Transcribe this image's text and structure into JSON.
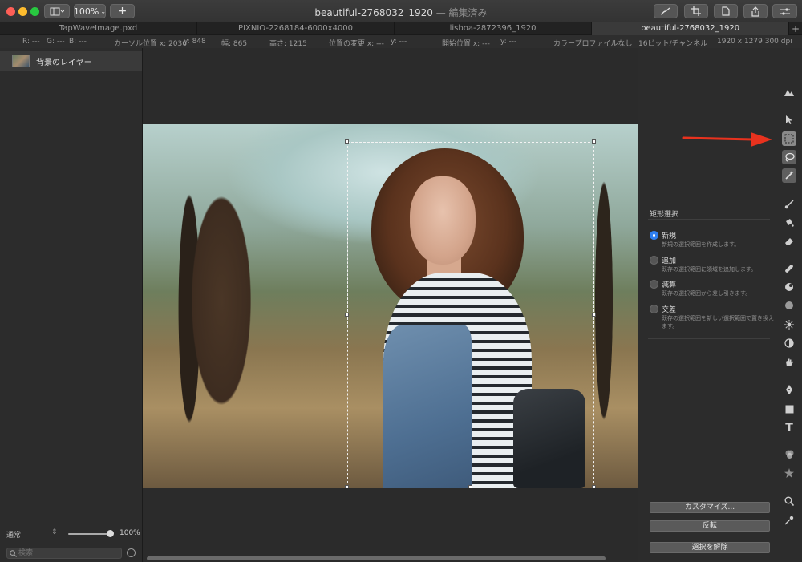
{
  "titlebar": {
    "title": "beautiful-2768032_1920",
    "subtitle": "— 編集済み",
    "zoom_label": "100%",
    "plus_label": "+"
  },
  "tabs": [
    {
      "label": "TapWaveImage.pxd"
    },
    {
      "label": "PIXNIO-2268184-6000x4000"
    },
    {
      "label": "lisboa-2872396_1920"
    },
    {
      "label": "beautiful-2768032_1920"
    }
  ],
  "tab_add": "+",
  "infobar": {
    "r": "R: ---",
    "g": "G: ---",
    "b": "B: ---",
    "cursor_x": "カーソル位置 x: 2036",
    "cursor_y": "y: 848",
    "width": "幅: 865",
    "height": "高さ: 1215",
    "offset_x": "位置の変更 x: ---",
    "offset_y": "y: ---",
    "start_x": "開始位置 x: ---",
    "start_y": "y: ---",
    "color_profile": "カラープロファイルなし",
    "bit_depth": "16ビット/チャンネル",
    "dimensions": "1920 x 1279 300 dpi"
  },
  "layers": {
    "items": [
      {
        "name": "背景のレイヤー"
      }
    ],
    "blend_mode": "通常",
    "opacity": "100%",
    "opacity_fraction": 1.0,
    "search_placeholder": "検索"
  },
  "tool_options": {
    "title": "矩形選択",
    "modes": [
      {
        "label": "新規",
        "desc": "新規の選択範囲を作成します。",
        "selected": true
      },
      {
        "label": "追加",
        "desc": "既存の選択範囲に領域を追加します。",
        "selected": false
      },
      {
        "label": "減算",
        "desc": "既存の選択範囲から差し引きます。",
        "selected": false
      },
      {
        "label": "交差",
        "desc": "既存の選択範囲を新しい選択範囲で置き換えます。",
        "selected": false
      }
    ],
    "customize_label": "カスタマイズ...",
    "invert_label": "反転",
    "deselect_label": "選択を解除"
  },
  "colors": {
    "accent": "#2f7ff0",
    "arrow": "#e8321e"
  }
}
